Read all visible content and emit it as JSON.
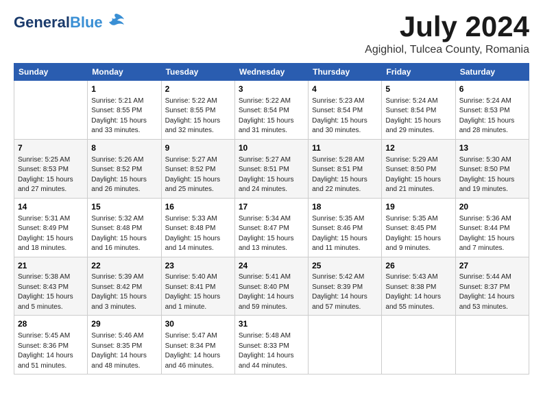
{
  "logo": {
    "line1": "General",
    "line2": "Blue"
  },
  "title": "July 2024",
  "subtitle": "Agighiol, Tulcea County, Romania",
  "weekdays": [
    "Sunday",
    "Monday",
    "Tuesday",
    "Wednesday",
    "Thursday",
    "Friday",
    "Saturday"
  ],
  "weeks": [
    [
      {
        "day": "",
        "info": ""
      },
      {
        "day": "1",
        "info": "Sunrise: 5:21 AM\nSunset: 8:55 PM\nDaylight: 15 hours\nand 33 minutes."
      },
      {
        "day": "2",
        "info": "Sunrise: 5:22 AM\nSunset: 8:55 PM\nDaylight: 15 hours\nand 32 minutes."
      },
      {
        "day": "3",
        "info": "Sunrise: 5:22 AM\nSunset: 8:54 PM\nDaylight: 15 hours\nand 31 minutes."
      },
      {
        "day": "4",
        "info": "Sunrise: 5:23 AM\nSunset: 8:54 PM\nDaylight: 15 hours\nand 30 minutes."
      },
      {
        "day": "5",
        "info": "Sunrise: 5:24 AM\nSunset: 8:54 PM\nDaylight: 15 hours\nand 29 minutes."
      },
      {
        "day": "6",
        "info": "Sunrise: 5:24 AM\nSunset: 8:53 PM\nDaylight: 15 hours\nand 28 minutes."
      }
    ],
    [
      {
        "day": "7",
        "info": "Sunrise: 5:25 AM\nSunset: 8:53 PM\nDaylight: 15 hours\nand 27 minutes."
      },
      {
        "day": "8",
        "info": "Sunrise: 5:26 AM\nSunset: 8:52 PM\nDaylight: 15 hours\nand 26 minutes."
      },
      {
        "day": "9",
        "info": "Sunrise: 5:27 AM\nSunset: 8:52 PM\nDaylight: 15 hours\nand 25 minutes."
      },
      {
        "day": "10",
        "info": "Sunrise: 5:27 AM\nSunset: 8:51 PM\nDaylight: 15 hours\nand 24 minutes."
      },
      {
        "day": "11",
        "info": "Sunrise: 5:28 AM\nSunset: 8:51 PM\nDaylight: 15 hours\nand 22 minutes."
      },
      {
        "day": "12",
        "info": "Sunrise: 5:29 AM\nSunset: 8:50 PM\nDaylight: 15 hours\nand 21 minutes."
      },
      {
        "day": "13",
        "info": "Sunrise: 5:30 AM\nSunset: 8:50 PM\nDaylight: 15 hours\nand 19 minutes."
      }
    ],
    [
      {
        "day": "14",
        "info": "Sunrise: 5:31 AM\nSunset: 8:49 PM\nDaylight: 15 hours\nand 18 minutes."
      },
      {
        "day": "15",
        "info": "Sunrise: 5:32 AM\nSunset: 8:48 PM\nDaylight: 15 hours\nand 16 minutes."
      },
      {
        "day": "16",
        "info": "Sunrise: 5:33 AM\nSunset: 8:48 PM\nDaylight: 15 hours\nand 14 minutes."
      },
      {
        "day": "17",
        "info": "Sunrise: 5:34 AM\nSunset: 8:47 PM\nDaylight: 15 hours\nand 13 minutes."
      },
      {
        "day": "18",
        "info": "Sunrise: 5:35 AM\nSunset: 8:46 PM\nDaylight: 15 hours\nand 11 minutes."
      },
      {
        "day": "19",
        "info": "Sunrise: 5:35 AM\nSunset: 8:45 PM\nDaylight: 15 hours\nand 9 minutes."
      },
      {
        "day": "20",
        "info": "Sunrise: 5:36 AM\nSunset: 8:44 PM\nDaylight: 15 hours\nand 7 minutes."
      }
    ],
    [
      {
        "day": "21",
        "info": "Sunrise: 5:38 AM\nSunset: 8:43 PM\nDaylight: 15 hours\nand 5 minutes."
      },
      {
        "day": "22",
        "info": "Sunrise: 5:39 AM\nSunset: 8:42 PM\nDaylight: 15 hours\nand 3 minutes."
      },
      {
        "day": "23",
        "info": "Sunrise: 5:40 AM\nSunset: 8:41 PM\nDaylight: 15 hours\nand 1 minute."
      },
      {
        "day": "24",
        "info": "Sunrise: 5:41 AM\nSunset: 8:40 PM\nDaylight: 14 hours\nand 59 minutes."
      },
      {
        "day": "25",
        "info": "Sunrise: 5:42 AM\nSunset: 8:39 PM\nDaylight: 14 hours\nand 57 minutes."
      },
      {
        "day": "26",
        "info": "Sunrise: 5:43 AM\nSunset: 8:38 PM\nDaylight: 14 hours\nand 55 minutes."
      },
      {
        "day": "27",
        "info": "Sunrise: 5:44 AM\nSunset: 8:37 PM\nDaylight: 14 hours\nand 53 minutes."
      }
    ],
    [
      {
        "day": "28",
        "info": "Sunrise: 5:45 AM\nSunset: 8:36 PM\nDaylight: 14 hours\nand 51 minutes."
      },
      {
        "day": "29",
        "info": "Sunrise: 5:46 AM\nSunset: 8:35 PM\nDaylight: 14 hours\nand 48 minutes."
      },
      {
        "day": "30",
        "info": "Sunrise: 5:47 AM\nSunset: 8:34 PM\nDaylight: 14 hours\nand 46 minutes."
      },
      {
        "day": "31",
        "info": "Sunrise: 5:48 AM\nSunset: 8:33 PM\nDaylight: 14 hours\nand 44 minutes."
      },
      {
        "day": "",
        "info": ""
      },
      {
        "day": "",
        "info": ""
      },
      {
        "day": "",
        "info": ""
      }
    ]
  ]
}
